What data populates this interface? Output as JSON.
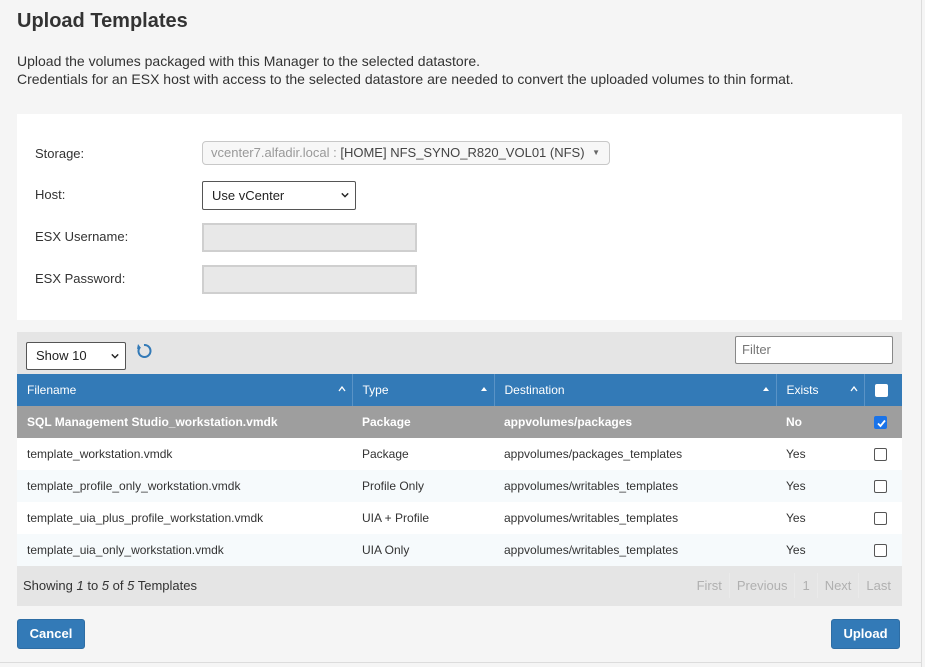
{
  "page": {
    "title": "Upload Templates",
    "description_line1": "Upload the volumes packaged with this Manager to the selected datastore.",
    "description_line2": "Credentials for an ESX host with access to the selected datastore are needed to convert the uploaded volumes to thin format."
  },
  "form": {
    "storage_label": "Storage:",
    "storage_host": "vcenter7.alfadir.local :",
    "storage_value": "[HOME] NFS_SYNO_R820_VOL01 (NFS)",
    "host_label": "Host:",
    "host_value": "Use vCenter",
    "username_label": "ESX Username:",
    "password_label": "ESX Password:"
  },
  "toolbar": {
    "show_value": "Show 10",
    "filter_placeholder": "Filter"
  },
  "table": {
    "headers": {
      "filename": "Filename",
      "type": "Type",
      "destination": "Destination",
      "exists": "Exists"
    },
    "rows": [
      {
        "filename": "SQL Management Studio_workstation.vmdk",
        "type": "Package",
        "destination": "appvolumes/packages",
        "exists": "No",
        "checked": true
      },
      {
        "filename": "template_workstation.vmdk",
        "type": "Package",
        "destination": "appvolumes/packages_templates",
        "exists": "Yes",
        "checked": false
      },
      {
        "filename": "template_profile_only_workstation.vmdk",
        "type": "Profile Only",
        "destination": "appvolumes/writables_templates",
        "exists": "Yes",
        "checked": false
      },
      {
        "filename": "template_uia_plus_profile_workstation.vmdk",
        "type": "UIA + Profile",
        "destination": "appvolumes/writables_templates",
        "exists": "Yes",
        "checked": false
      },
      {
        "filename": "template_uia_only_workstation.vmdk",
        "type": "UIA Only",
        "destination": "appvolumes/writables_templates",
        "exists": "Yes",
        "checked": false
      }
    ]
  },
  "footer": {
    "showing_prefix": "Showing ",
    "showing_from": "1",
    "showing_to_word": " to ",
    "showing_to": "5",
    "showing_of_word": " of ",
    "showing_total": "5",
    "showing_suffix": " Templates",
    "pager": {
      "first": "First",
      "previous": "Previous",
      "page": "1",
      "next": "Next",
      "last": "Last"
    }
  },
  "actions": {
    "cancel_label": "Cancel",
    "upload_label": "Upload"
  },
  "colors": {
    "header_blue": "#337ab7",
    "selected_row": "#9e9e9e",
    "checkbox_checked": "#1a73e8"
  },
  "icons": {
    "refresh": "refresh-icon",
    "sort": "sort-asc-icon",
    "dropdown": "chevron-down-icon"
  }
}
